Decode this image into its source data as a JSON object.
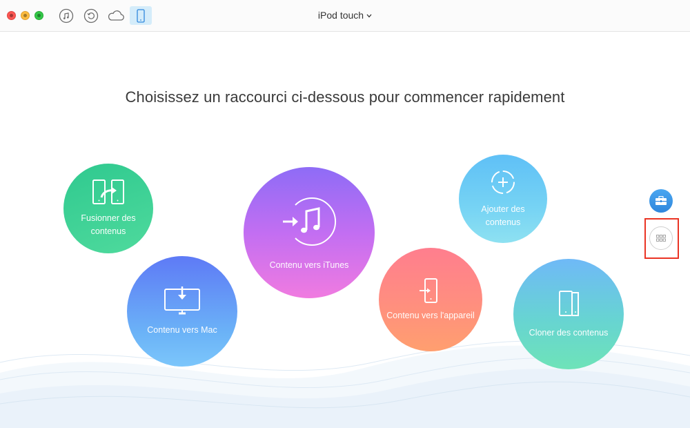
{
  "titlebar": {
    "device_name": "iPod touch",
    "toolbar_icons": [
      "music-icon",
      "restore-icon",
      "cloud-icon",
      "device-icon"
    ]
  },
  "main": {
    "headline": "Choisissez un raccourci ci-dessous pour commencer rapidement",
    "shortcuts": [
      {
        "id": "merge",
        "label_line1": "Fusionner des",
        "label_line2": "contenus",
        "icon": "merge-icon"
      },
      {
        "id": "to-mac",
        "label": "Contenu vers Mac",
        "icon": "monitor-download-icon"
      },
      {
        "id": "to-itunes",
        "label": "Contenu vers iTunes",
        "icon": "music-note-icon"
      },
      {
        "id": "to-device",
        "label": "Contenu vers l'appareil",
        "icon": "phone-import-icon"
      },
      {
        "id": "add",
        "label_line1": "Ajouter des",
        "label_line2": "contenus",
        "icon": "add-icon"
      },
      {
        "id": "clone",
        "label": "Cloner des contenus",
        "icon": "clone-icon"
      }
    ]
  },
  "side": {
    "toolbox_icon": "toolbox-icon",
    "grid_icon": "grid-icon"
  },
  "colors": {
    "accent": "#2f87dd",
    "highlight": "#ea3323",
    "device_button_bg": "#d4ecfa"
  }
}
